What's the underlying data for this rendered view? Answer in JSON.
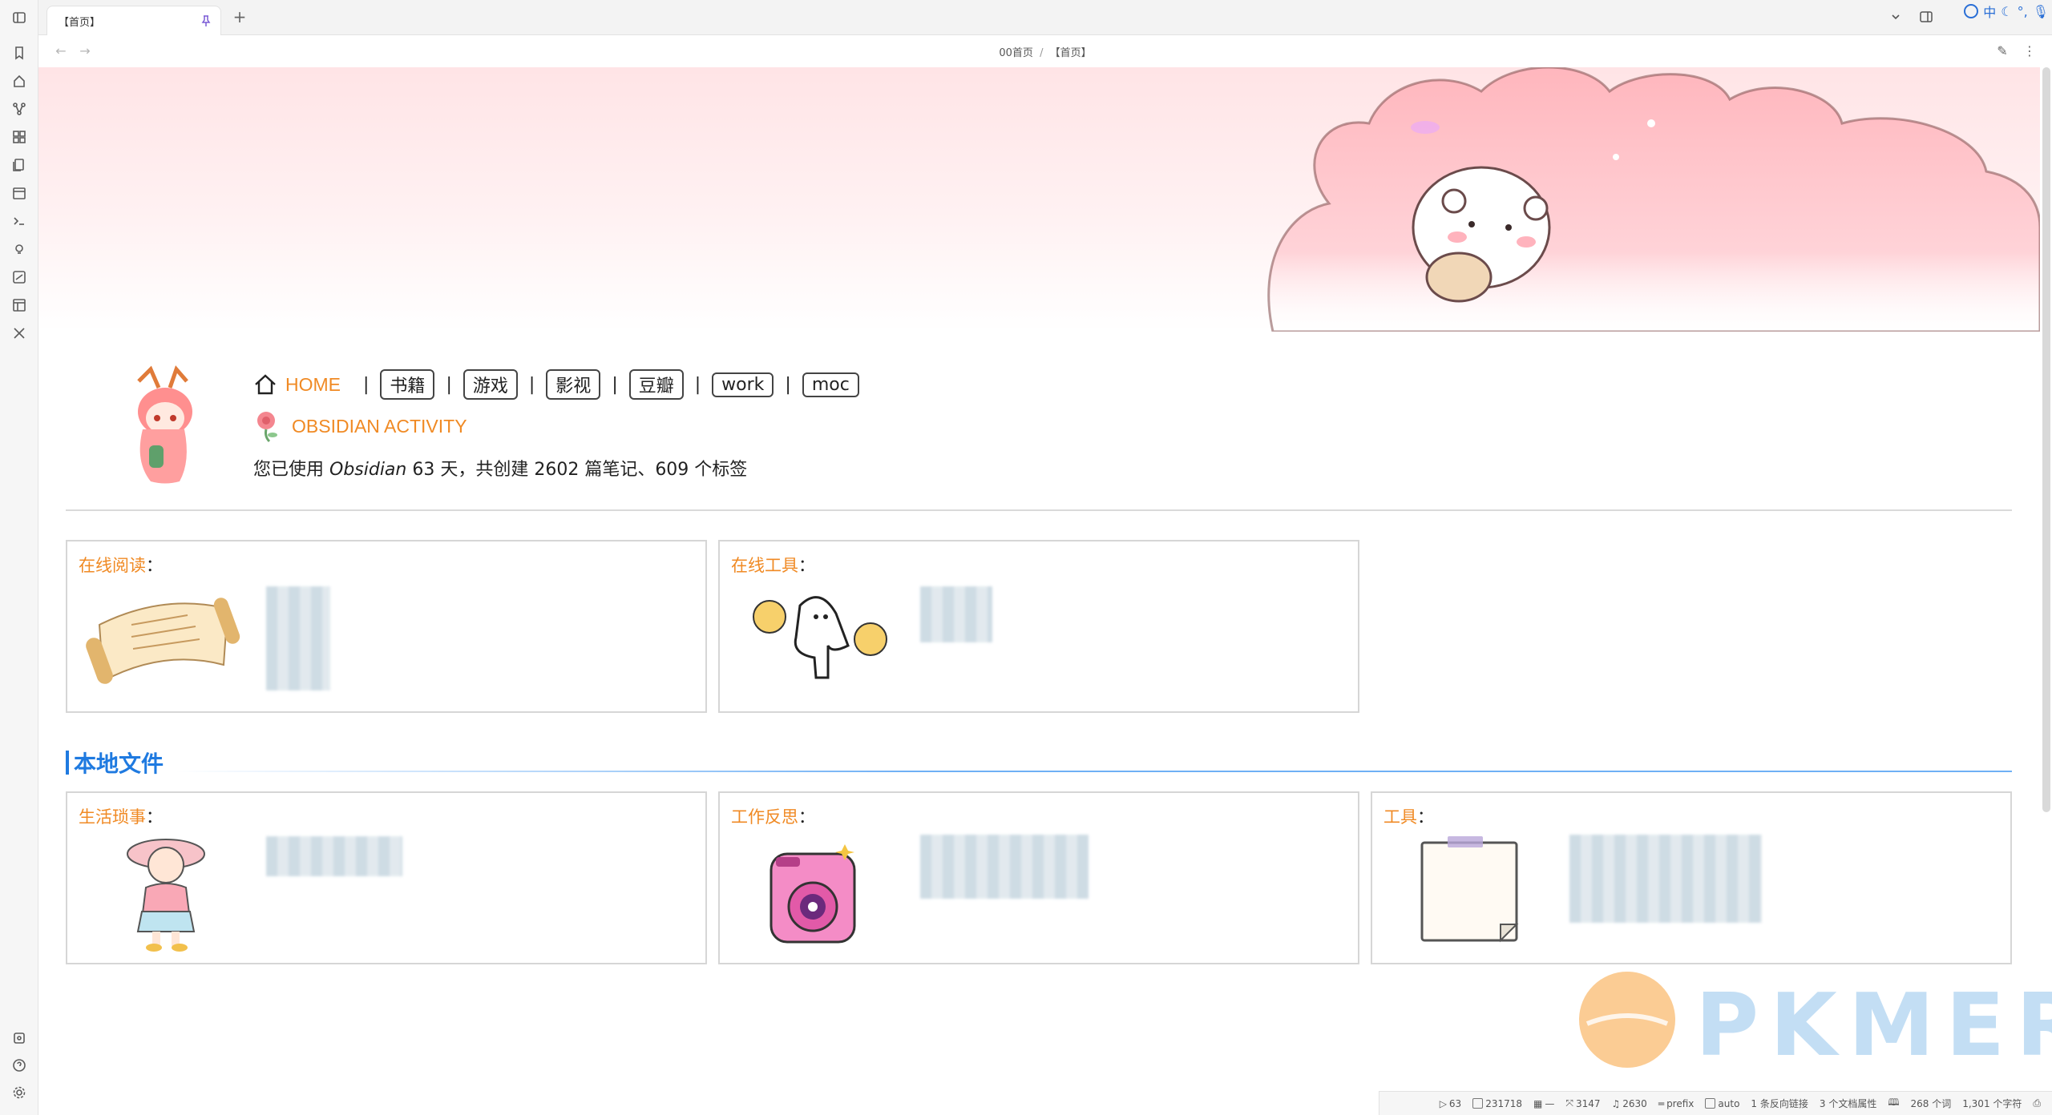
{
  "tab": {
    "title": "【首页】"
  },
  "breadcrumb": {
    "folder": "00首页",
    "separator": "/",
    "file": "【首页】"
  },
  "ime": {
    "mode": "中"
  },
  "nav": {
    "home_label": "HOME",
    "separator": "|",
    "links": [
      "书籍",
      "游戏",
      "影视",
      "豆瓣",
      "work",
      "moc"
    ]
  },
  "activity": {
    "label": "OBSIDIAN ACTIVITY",
    "stats_prefix": "您已使用 ",
    "app_name": "Obsidian",
    "stats_suffix": " 63 天，共创建 2602 篇笔记、609 个标签"
  },
  "cards_top": [
    {
      "title": "在线阅读",
      "colon": "：",
      "image": "scroll-illustration"
    },
    {
      "title": "在线工具",
      "colon": "：",
      "image": "ghost-cheerleader-illustration"
    }
  ],
  "section": {
    "title": "本地文件"
  },
  "cards_bottom": [
    {
      "title": "生活琐事",
      "colon": "：",
      "image": "girl-hat-illustration"
    },
    {
      "title": "工作反思",
      "colon": "：",
      "image": "pink-camera-illustration"
    },
    {
      "title": "工具",
      "colon": "：",
      "image": "notepad-illustration"
    }
  ],
  "statusbar": {
    "items": [
      "63",
      "231718",
      "—",
      "3147",
      "2630",
      "prefix",
      "auto",
      "1 条反向链接",
      "3 个文档属性",
      "268 个词",
      "1,301 个字符"
    ]
  },
  "watermark": {
    "text": "PKMER"
  },
  "colors": {
    "accent_orange": "#f08a24",
    "section_blue": "#1f7ae0",
    "banner_pink": "#ffd0d6"
  }
}
